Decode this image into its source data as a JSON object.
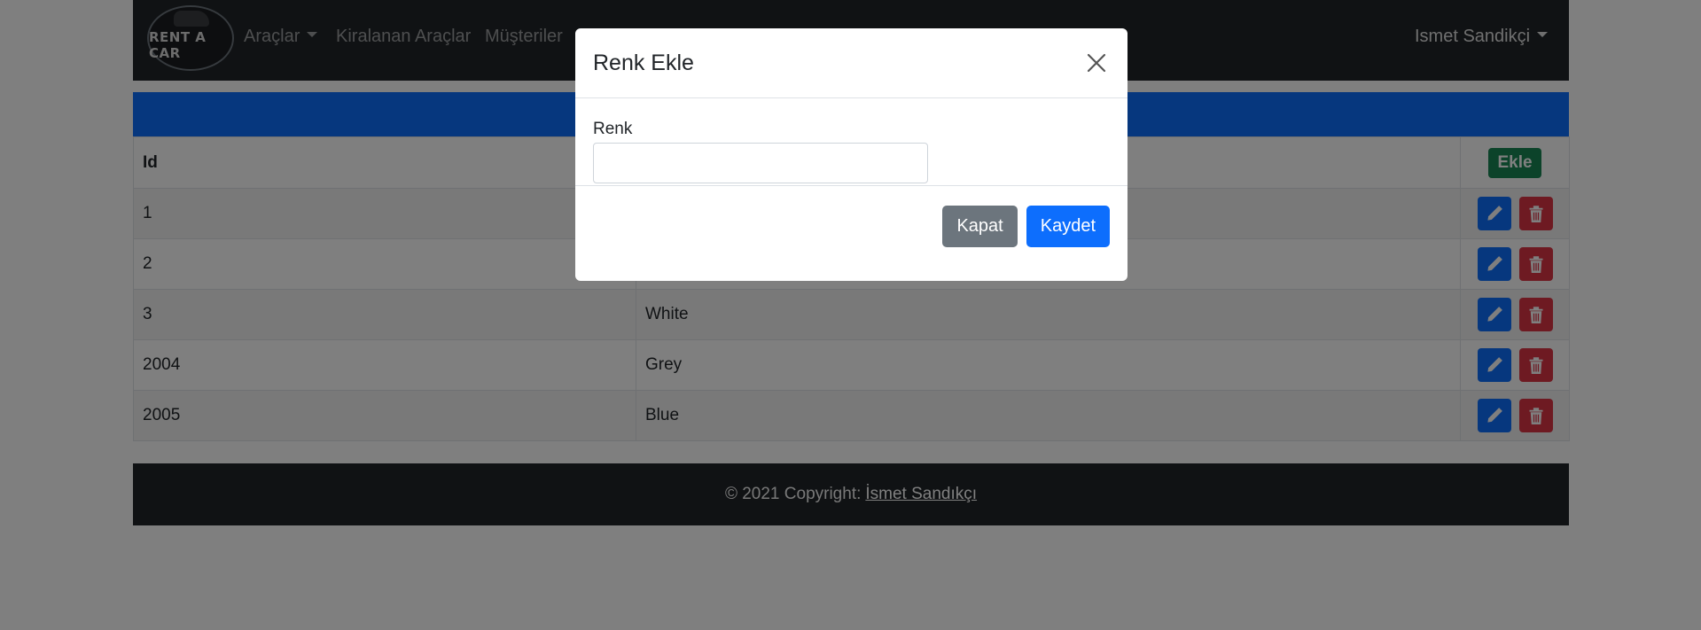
{
  "navbar": {
    "logo_text": "RENT A CAR",
    "links": [
      {
        "label": "Araçlar",
        "dropdown": true
      },
      {
        "label": "Kiralanan Araçlar",
        "dropdown": false
      },
      {
        "label": "Müşteriler",
        "dropdown": false
      }
    ],
    "user_name": "Ismet Sandikçi"
  },
  "table": {
    "headers": {
      "id": "Id",
      "add_button": "Ekle"
    },
    "rows": [
      {
        "id": "1",
        "name": ""
      },
      {
        "id": "2",
        "name": ""
      },
      {
        "id": "3",
        "name": "White"
      },
      {
        "id": "2004",
        "name": "Grey"
      },
      {
        "id": "2005",
        "name": "Blue"
      }
    ]
  },
  "footer": {
    "text": "© 2021 Copyright:",
    "link": "İsmet Sandıkçı"
  },
  "modal": {
    "title": "Renk Ekle",
    "field_label": "Renk",
    "field_value": "",
    "close_button": "Kapat",
    "save_button": "Kaydet"
  },
  "colors": {
    "navbar_bg": "#212529",
    "primary": "#0d6efd",
    "success": "#198754",
    "danger": "#dc3545",
    "secondary": "#6c757d"
  }
}
